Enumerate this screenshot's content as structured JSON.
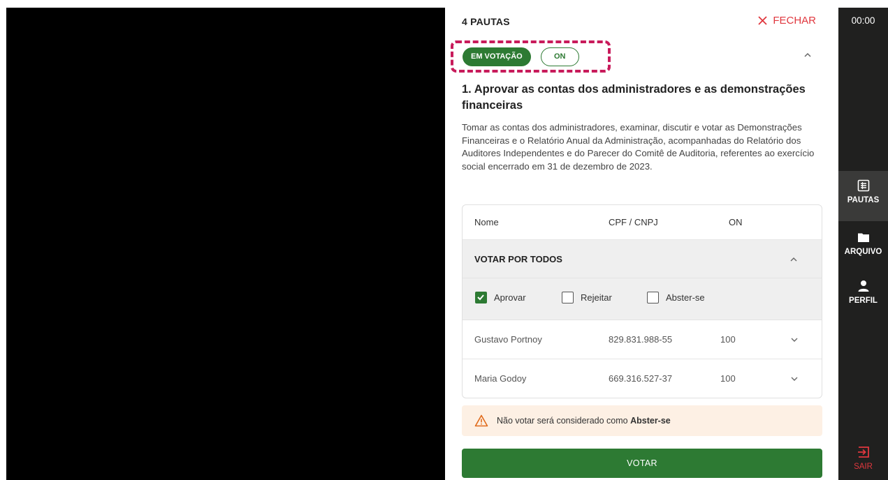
{
  "panel": {
    "title": "4 PAUTAS",
    "close_label": "FECHAR",
    "status_badge": "EM VOTAÇÃO",
    "share_badge": "ON",
    "agenda_title": "1. Aprovar as contas dos administradores e as demonstrações financeiras",
    "agenda_description": "Tomar as contas dos administradores, examinar, discutir e votar as Demonstrações Financeiras e o Relatório Anual da Administração, acompanhadas do Relatório dos Auditores Independentes e do Parecer do Comitê de Auditoria, referentes ao exercício social encerrado em 31 de dezembro de 2023."
  },
  "table": {
    "headers": [
      "Nome",
      "CPF / CNPJ",
      "ON"
    ],
    "vote_all_label": "VOTAR POR TODOS",
    "options": [
      {
        "label": "Aprovar",
        "checked": true
      },
      {
        "label": "Rejeitar",
        "checked": false
      },
      {
        "label": "Abster-se",
        "checked": false
      }
    ],
    "rows": [
      {
        "name": "Gustavo Portnoy",
        "doc": "829.831.988-55",
        "shares": "100"
      },
      {
        "name": "Maria Godoy",
        "doc": "669.316.527-37",
        "shares": "100"
      }
    ]
  },
  "warning": {
    "text": "Não votar será considerado como",
    "emphasis": "Abster-se"
  },
  "vote_button": "VOTAR",
  "sidebar": {
    "timer": "00:00",
    "items": [
      {
        "label": "PAUTAS",
        "icon": "list-icon",
        "active": true
      },
      {
        "label": "ARQUIVO",
        "icon": "folder-icon",
        "active": false
      },
      {
        "label": "PERFIL",
        "icon": "person-icon",
        "active": false
      }
    ],
    "exit_label": "SAIR"
  },
  "colors": {
    "accent_green": "#2d7a33",
    "close_red": "#e0373e",
    "highlight_magenta": "#c81b5b",
    "sidebar_bg": "#20201f",
    "warning_bg": "#fdf0e4",
    "warning_icon": "#e06a1a"
  }
}
